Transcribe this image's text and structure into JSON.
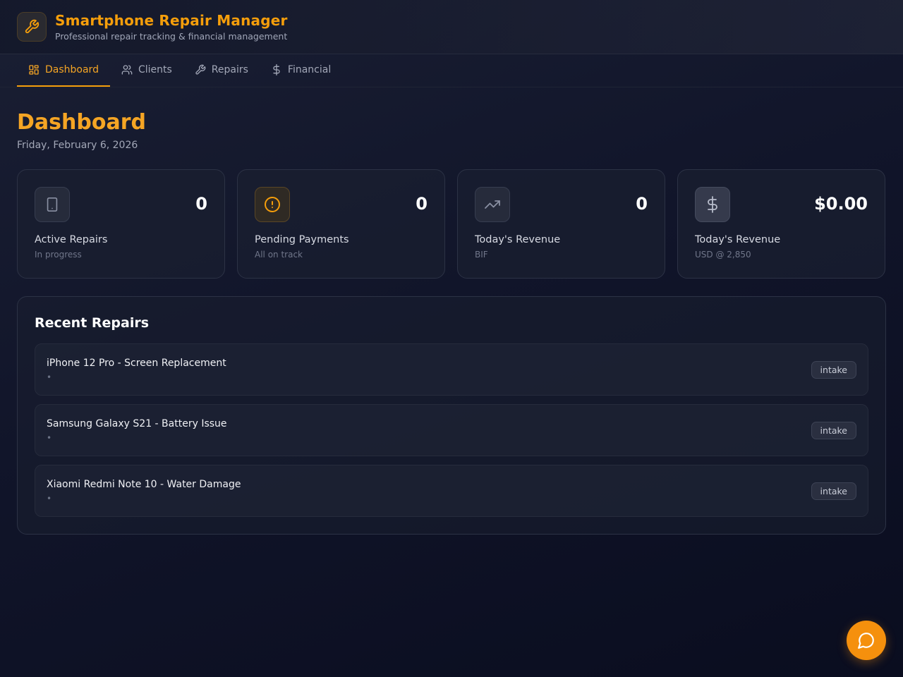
{
  "app": {
    "title": "Smartphone Repair Manager",
    "subtitle": "Professional repair tracking & financial management",
    "icon": "wrench-icon",
    "accent_color": "#f59e0b"
  },
  "nav": {
    "tabs": [
      {
        "label": "Dashboard",
        "icon": "dashboard-grid-icon",
        "active": true
      },
      {
        "label": "Clients",
        "icon": "users-icon",
        "active": false
      },
      {
        "label": "Repairs",
        "icon": "wrench-icon",
        "active": false
      },
      {
        "label": "Financial",
        "icon": "dollar-icon",
        "active": false
      }
    ]
  },
  "page": {
    "title": "Dashboard",
    "date": "Friday, February 6, 2026"
  },
  "stats": [
    {
      "value": "0",
      "label": "Active Repairs",
      "sub": "In progress",
      "icon": "smartphone-icon"
    },
    {
      "value": "0",
      "label": "Pending Payments",
      "sub": "All on track",
      "icon": "alert-circle-icon"
    },
    {
      "value": "0",
      "label": "Today's Revenue",
      "sub": "BIF",
      "icon": "trending-up-icon"
    },
    {
      "value": "$0.00",
      "label": "Today's Revenue",
      "sub": "USD @ 2,850",
      "icon": "dollar-icon"
    }
  ],
  "recent": {
    "title": "Recent Repairs",
    "items": [
      {
        "name": "iPhone 12 Pro - Screen Replacement",
        "meta": "•",
        "status": "intake"
      },
      {
        "name": "Samsung Galaxy S21 - Battery Issue",
        "meta": "•",
        "status": "intake"
      },
      {
        "name": "Xiaomi Redmi Note 10 - Water Damage",
        "meta": "•",
        "status": "intake"
      }
    ]
  },
  "fab": {
    "icon": "chat-bubble-icon"
  }
}
